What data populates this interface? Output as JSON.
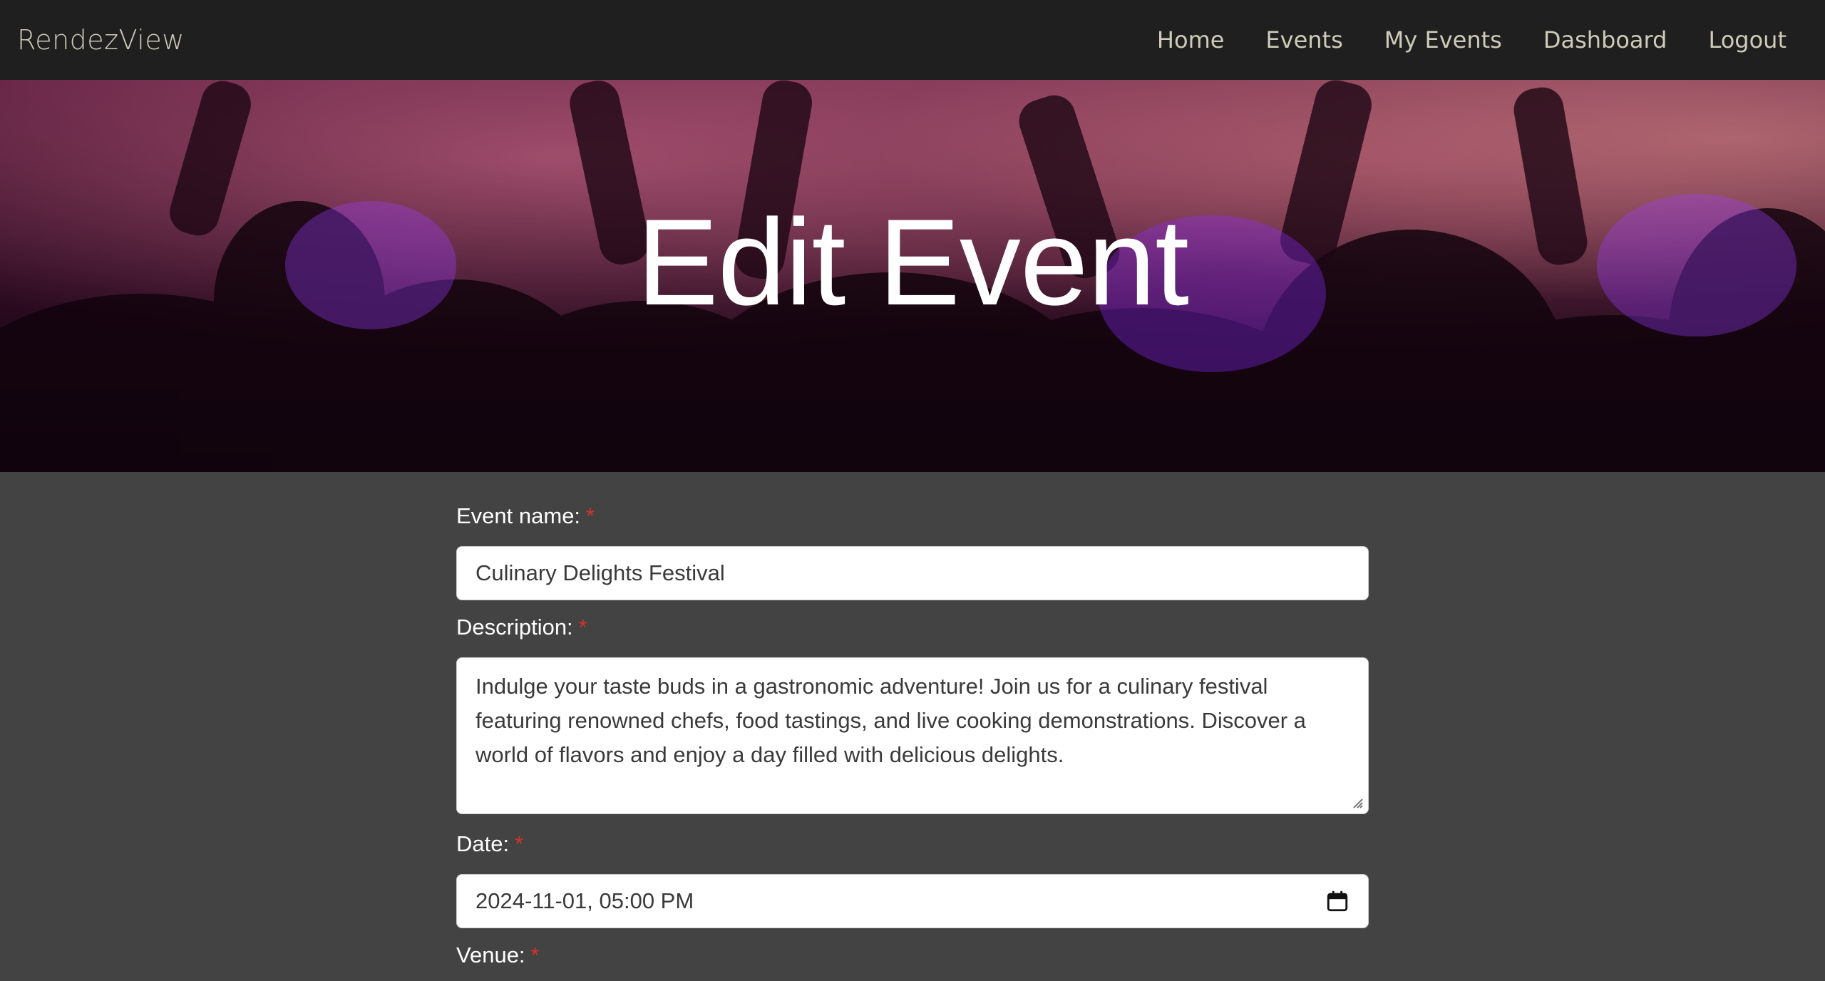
{
  "nav": {
    "brand": "RendezView",
    "links": [
      "Home",
      "Events",
      "My Events",
      "Dashboard",
      "Logout"
    ]
  },
  "hero": {
    "title": "Edit Event"
  },
  "form": {
    "event_name": {
      "label": "Event name:",
      "required_mark": "*",
      "value": "Culinary Delights Festival"
    },
    "description": {
      "label": "Description:",
      "required_mark": "*",
      "value": "Indulge your taste buds in a gastronomic adventure! Join us for a culinary festival featuring renowned chefs, food tastings, and live cooking demonstrations. Discover a world of flavors and enjoy a day filled with delicious delights."
    },
    "date": {
      "label": "Date:",
      "required_mark": "*",
      "value": "2024-11-01, 05:00 PM"
    },
    "venue": {
      "label": "Venue:",
      "required_mark": "*"
    }
  },
  "icons": {
    "calendar": "calendar-icon",
    "resize": "textarea-resize-icon"
  },
  "colors": {
    "navbar_bg": "#1f1f1f",
    "page_bg": "#434343",
    "nav_text": "#cfcbb8",
    "required": "#d0332b"
  }
}
